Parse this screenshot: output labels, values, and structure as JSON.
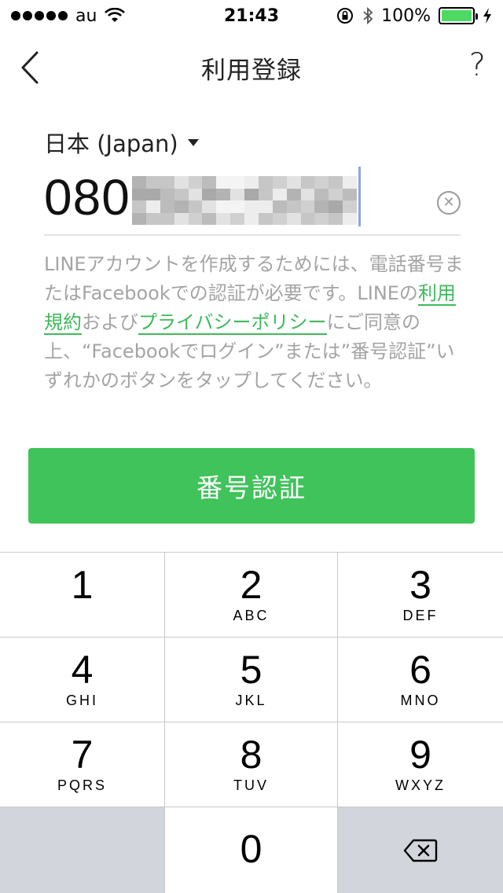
{
  "status_bar": {
    "carrier": "au",
    "time": "21:43",
    "battery": "100%",
    "battery_level": 1.0,
    "signal_bars": 5
  },
  "nav": {
    "title": "利用登録",
    "help": "?"
  },
  "form": {
    "country": "日本 (Japan)",
    "phone_prefix": "080"
  },
  "info": {
    "text_1": "LINEアカウントを作成するためには、電話番号またはFacebookでの認証が必要です。LINEの",
    "link_terms": "利用規約",
    "text_2": "および",
    "link_privacy": "プライバシーポリシー",
    "text_3": "にご同意の上、“Facebookでログイン”または”番号認証”いずれかのボタンをタップしてください。"
  },
  "verify_button": "番号認証",
  "keypad": [
    {
      "num": "1",
      "letters": ""
    },
    {
      "num": "2",
      "letters": "ABC"
    },
    {
      "num": "3",
      "letters": "DEF"
    },
    {
      "num": "4",
      "letters": "GHI"
    },
    {
      "num": "5",
      "letters": "JKL"
    },
    {
      "num": "6",
      "letters": "MNO"
    },
    {
      "num": "7",
      "letters": "PQRS"
    },
    {
      "num": "8",
      "letters": "TUV"
    },
    {
      "num": "9",
      "letters": "WXYZ"
    },
    {
      "num": "0",
      "letters": ""
    }
  ],
  "colors": {
    "accent_green": "#3fc35a",
    "link_green": "#3fba5a",
    "battery_green": "#4cd964",
    "key_gray": "#d2d5db"
  },
  "icons": {
    "back": "chevron-left-icon",
    "clear": "clear-circle-icon",
    "backspace": "backspace-icon",
    "wifi": "wifi-icon",
    "bluetooth": "bluetooth-icon",
    "rotation_lock": "rotation-lock-icon",
    "charging": "charging-bolt-icon"
  }
}
